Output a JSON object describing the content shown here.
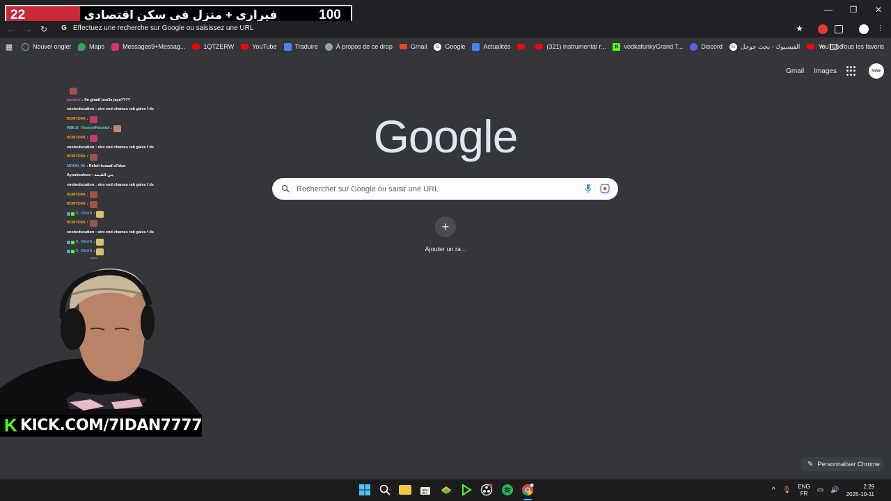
{
  "banner": {
    "left_number": "22",
    "title": "فيراري + منزل في سكن اقتصادي",
    "right_number": "100"
  },
  "window_controls": [
    "—",
    "❐",
    "✕"
  ],
  "toolbar": {
    "omnibox_text": "Effectuez une recherche sur Google ou saisissez une URL"
  },
  "bookmarks": [
    {
      "label": "Nouvel onglet",
      "icon": "globe-icon",
      "color": "#8ab4f8"
    },
    {
      "label": "Maps",
      "icon": "maps-icon",
      "color": "#34a853"
    },
    {
      "label": "Messages9+Messag...",
      "icon": "instagram-icon",
      "color": "#e1306c"
    },
    {
      "label": "1QTZERW",
      "icon": "youtube-icon",
      "color": "#ff0000"
    },
    {
      "label": "YouTube",
      "icon": "youtube-icon",
      "color": "#ff0000"
    },
    {
      "label": "Traduire",
      "icon": "translate-icon",
      "color": "#4285f4"
    },
    {
      "label": "À propos de ce drop",
      "icon": "globe-icon",
      "color": "#9aa0a6"
    },
    {
      "label": "Gmail",
      "icon": "gmail-icon",
      "color": "#ea4335"
    },
    {
      "label": "Google",
      "icon": "google-icon",
      "color": "#ffffff"
    },
    {
      "label": "Actualités",
      "icon": "news-icon",
      "color": "#4285f4"
    },
    {
      "label": "",
      "icon": "youtube-icon",
      "color": "#ff0000"
    },
    {
      "label": "(321) instrumental r...",
      "icon": "youtube-icon",
      "color": "#ff0000"
    },
    {
      "label": "vodkafunkyGrand T...",
      "icon": "kick-icon",
      "color": "#53fc18"
    },
    {
      "label": "Discord",
      "icon": "discord-icon",
      "color": "#5865f2"
    },
    {
      "label": "الفيسبوك - بحث جوجل",
      "icon": "google-icon",
      "color": "#ffffff"
    },
    {
      "label": "YouTube",
      "icon": "youtube-icon",
      "color": "#ff0000"
    }
  ],
  "bookmarks_more": "»",
  "bookmarks_all": "Tous les favoris",
  "google_links": {
    "gmail": "Gmail",
    "images": "Images"
  },
  "avatar_text": "hidan",
  "logo": {
    "text": "Google"
  },
  "search": {
    "placeholder": "Rechercher sur Google ou saisir une URL"
  },
  "shortcut": {
    "symbol": "+",
    "label": "Ajouter un ra..."
  },
  "chat": [
    {
      "user": "",
      "color": "#ffffff",
      "message": "",
      "emote": "#a0524a"
    },
    {
      "user": "joudree",
      "color": "#c45bd2",
      "message": ": fin ghadi jem3a jaya????",
      "emote": ""
    },
    {
      "user": "snobeducation",
      "color": "#ffffff",
      "message": ": siro end chamss rah gales f ds",
      "emote": ""
    },
    {
      "user": "BORTO9A",
      "color": "#f5a623",
      "message": ":",
      "emote": "#c83a6a"
    },
    {
      "user": "WBLG_YoussefNourabi",
      "color": "#6fd3c5",
      "message": ":",
      "emote": "#c08a6a"
    },
    {
      "user": "BORTO9A",
      "color": "#f5a623",
      "message": ":",
      "emote": "#c83a6a"
    },
    {
      "user": "snobeducation",
      "color": "#ffffff",
      "message": ": siro end chamss rah gales f ds",
      "emote": ""
    },
    {
      "user": "BORTO9A",
      "color": "#f5a623",
      "message": ":",
      "emote": "#a0524a"
    },
    {
      "user": "MOON_66",
      "color": "#6fa8ff",
      "message": ": Refeti bzaaaf a7idan",
      "emote": ""
    },
    {
      "user": "Ayoubsafess",
      "color": "#ffffff",
      "message": ": جي القيمة",
      "emote": ""
    },
    {
      "user": "snobeducation",
      "color": "#ffffff",
      "message": ": siro end chamss rah gales f ds",
      "emote": ""
    },
    {
      "user": "BORTO9A",
      "color": "#f5a623",
      "message": ":",
      "emote": "#a0524a"
    },
    {
      "user": "BORTO9A",
      "color": "#f5a623",
      "message": ":",
      "emote": "#a0524a"
    },
    {
      "user": "7I_OMAR",
      "color": "#5b9bd5",
      "message": ":",
      "emote": "#d4c270",
      "badge": true
    },
    {
      "user": "BORTO9A",
      "color": "#f5a623",
      "message": ":",
      "emote": "#a0524a"
    },
    {
      "user": "snobeducation",
      "color": "#ffffff",
      "message": ": siro end chamss rah gales f ds",
      "emote": ""
    },
    {
      "user": "7I_OMAR",
      "color": "#5b9bd5",
      "message": ":",
      "emote": "#d4c270",
      "badge": true
    },
    {
      "user": "7I_OMAR",
      "color": "#5b9bd5",
      "message": ":",
      "emote": "#d4c270",
      "badge": true
    },
    {
      "user": "BORTO9A",
      "color": "#f5a623",
      "message": ":",
      "emote": "#a0524a"
    }
  ],
  "kick": {
    "text": "KICK.COM/7IDAN7777",
    "logo": "K"
  },
  "customize": {
    "label": "Personnaliser Chrome"
  },
  "tray": {
    "lang_top": "ENG",
    "lang_bottom": "FR",
    "time": "2:29",
    "date": "2025-10-11"
  },
  "colors": {
    "background": "#35363a",
    "chrome_dark": "#202124",
    "kick_green": "#53fc18",
    "banner_red": "#c8283a"
  }
}
